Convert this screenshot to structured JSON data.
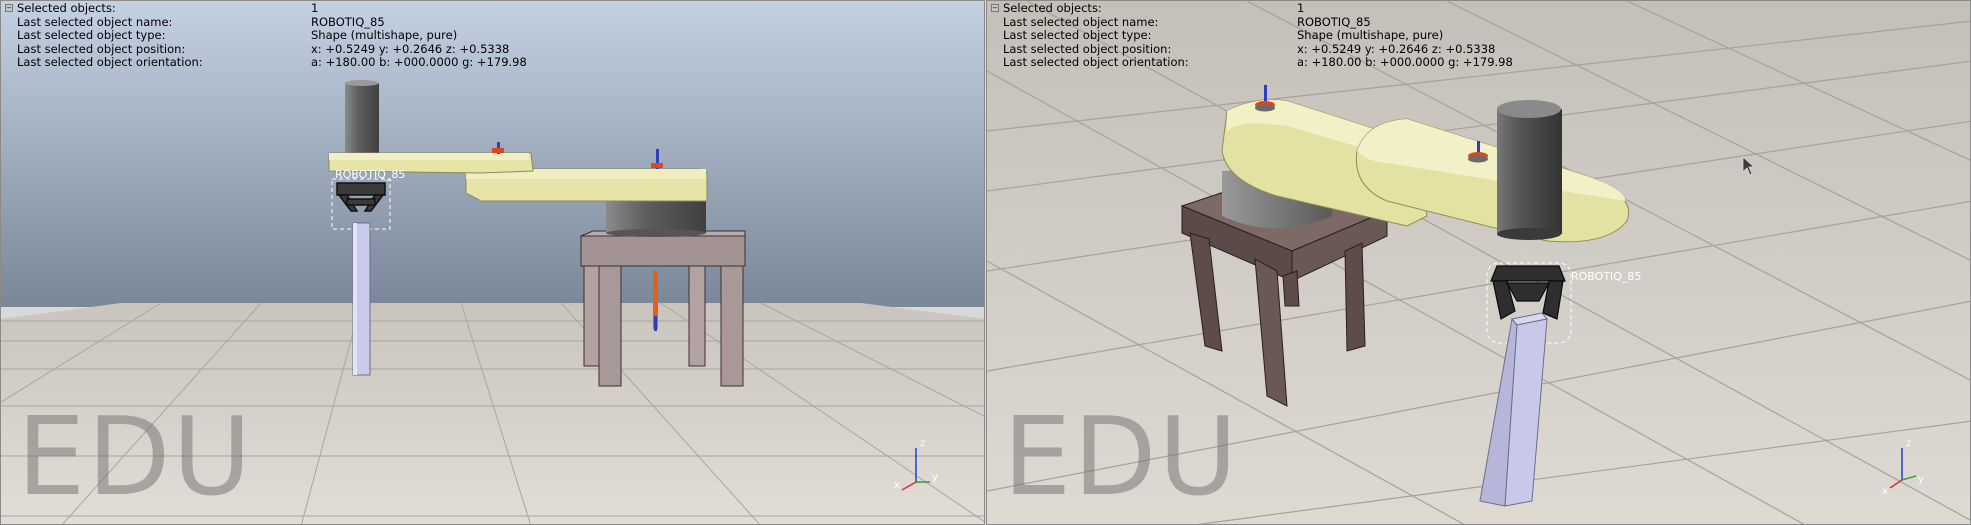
{
  "viewports": [
    {
      "info": {
        "rows": [
          {
            "label": "Selected objects:",
            "value": "1"
          },
          {
            "label": "Last selected object name:",
            "value": "ROBOTIQ_85"
          },
          {
            "label": "Last selected object type:",
            "value": "Shape (multishape, pure)"
          },
          {
            "label": "Last selected object position:",
            "value": "x: +0.5249    y: +0.2646    z: +0.5338"
          },
          {
            "label": "Last selected object orientation:",
            "value": "a: +180.00    b: +000.0000    g: +179.98"
          }
        ]
      },
      "watermark": "EDU",
      "object_label": "ROBOTIQ_85",
      "axes": {
        "x": "x",
        "y": "y",
        "z": "z"
      }
    },
    {
      "info": {
        "rows": [
          {
            "label": "Selected objects:",
            "value": "1"
          },
          {
            "label": "Last selected object name:",
            "value": "ROBOTIQ_85"
          },
          {
            "label": "Last selected object type:",
            "value": "Shape (multishape, pure)"
          },
          {
            "label": "Last selected object position:",
            "value": "x: +0.5249    y: +0.2646    z: +0.5338"
          },
          {
            "label": "Last selected object orientation:",
            "value": "a: +180.00    b: +000.0000    g: +179.98"
          }
        ]
      },
      "watermark": "EDU",
      "object_label": "ROBOTIQ_85",
      "axes": {
        "x": "x",
        "y": "y",
        "z": "z"
      }
    }
  ],
  "colors": {
    "sky_top": "#c2cfe0",
    "sky_bottom": "#7b889b",
    "floor": "#d7d3cc",
    "arm": "#e6e4a3",
    "table": "#9e8e8e",
    "column": "#6b6b6b",
    "pillar": "#c4c4e6"
  }
}
